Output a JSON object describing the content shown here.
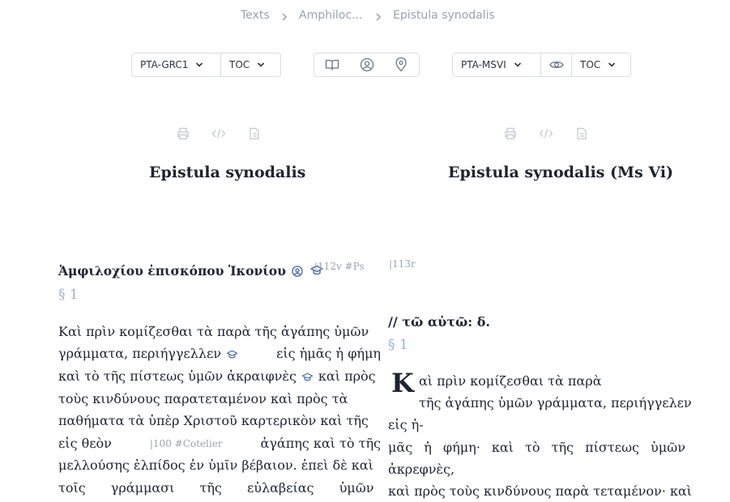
{
  "breadcrumb": {
    "items": [
      "Texts",
      "Amphiloc...",
      "Epistula synodalis"
    ]
  },
  "left_toolbar": {
    "edition": "PTA-GRC1",
    "toc": "TOC"
  },
  "center_toolbar": {
    "icons": [
      "book-open-icon",
      "user-circle-icon",
      "map-pin-icon"
    ]
  },
  "right_toolbar": {
    "edition": "PTA-MSVI",
    "toc": "TOC"
  },
  "left": {
    "title": "Epistula synodalis",
    "heading": "Ἀμφιλοχίου ἐπισκόπου Ἰκονίου",
    "folio": "|112v #Ps",
    "section": "§ 1",
    "lines": [
      [
        "Καὶ πρὶν κομίζεσθαι τὰ παρὰ τῆς ἀγάπης ὑμῶν"
      ],
      [
        "γράμματα, περιήγγελλεν",
        "εἰς ἡμᾶς ἡ φήμη"
      ],
      [
        "καὶ τὸ τῆς πίστεως ὑμῶν ἀκραιφνὲς",
        "καὶ πρὸς"
      ],
      [
        "τοὺς κινδύνους παρατεταμένον καὶ πρὸς τὰ"
      ],
      [
        "παθήματα τὰ ὑπὲρ Χριστοῦ καρτερικὸν καὶ τῆς"
      ],
      [
        "εἰς θεὸν",
        "|100 #Cotelier",
        "ἀγάπης καὶ τὸ τῆς"
      ],
      [
        "μελλούσης ἐλπίδος ἐν ὑμῖν βέβαιον. ἐπεὶ δὲ καὶ"
      ],
      [
        "τοῖς γράμμασι τῆς εὐλαβείας ὑμῶν"
      ]
    ]
  },
  "right": {
    "title": "Epistula synodalis (Ms Vi)",
    "folio": "|113r",
    "heading": "// τῶ αὐτῶ: δ.",
    "section": "§ 1",
    "dropcap": "K",
    "lines": [
      "αὶ πρὶν κομίζεσθαι τὰ παρὰ",
      "τῆς ἀγάπης ὑμῶν γράμματα, περιήγγελεν",
      "εἰς ἡ-",
      "μᾶς ἡ φήμη· καὶ τὸ τῆς πίστεως ὑμῶν",
      "ἀκρεφνὲς,",
      "καὶ πρὸς τοὺς κινδύνους παρὰ τεταμένον· καὶ"
    ]
  },
  "colors": {
    "muted": "#9aa2b1",
    "section": "#9ab3d2",
    "accent": "#3f63a8",
    "border": "#d9dee6"
  }
}
